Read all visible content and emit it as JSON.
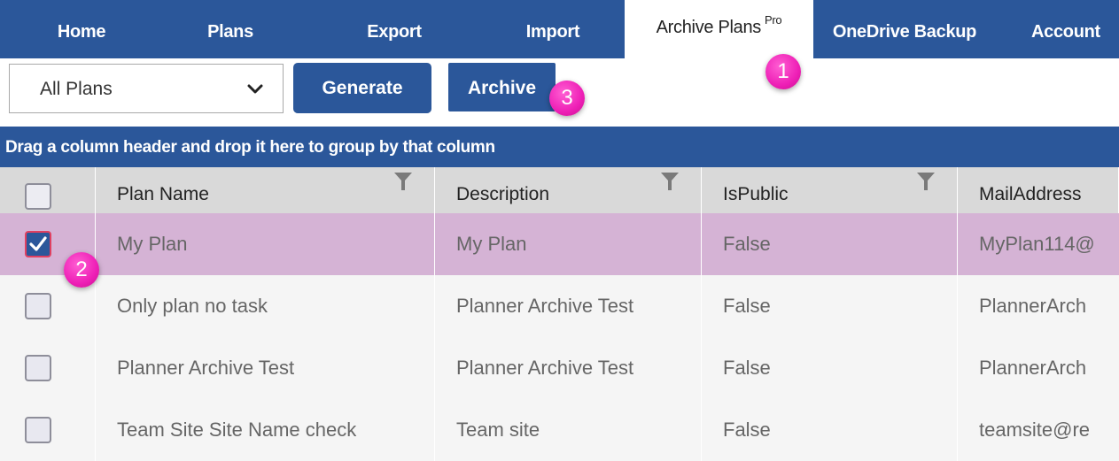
{
  "nav": {
    "tabs": [
      {
        "label": "Home"
      },
      {
        "label": "Plans"
      },
      {
        "label": "Export"
      },
      {
        "label": "Import"
      },
      {
        "label": "Archive Plans",
        "superscript": "Pro",
        "active": true
      },
      {
        "label": "OneDrive Backup"
      },
      {
        "label": "Account"
      }
    ]
  },
  "toolbar": {
    "plan_filter_value": "All Plans",
    "generate_label": "Generate",
    "archive_label": "Archive"
  },
  "badges": [
    "1",
    "2",
    "3"
  ],
  "grid": {
    "group_hint": "Drag a column header and drop it here to group by that column",
    "columns": [
      "Plan Name",
      "Description",
      "IsPublic",
      "MailAddress"
    ],
    "rows": [
      {
        "checked": true,
        "cells": [
          "My Plan",
          "My Plan",
          "False",
          "MyPlan114@"
        ]
      },
      {
        "checked": false,
        "cells": [
          "Only plan no task",
          "Planner Archive Test",
          "False",
          "PlannerArch"
        ]
      },
      {
        "checked": false,
        "cells": [
          "Planner Archive Test",
          "Planner Archive Test",
          "False",
          "PlannerArch"
        ]
      },
      {
        "checked": false,
        "cells": [
          "Team Site Site Name check",
          "Team site",
          "False",
          "teamsite@re"
        ]
      }
    ]
  },
  "colors": {
    "brand": "#2b579a",
    "selected_row": "#d5b3d5",
    "badge": "#ee1fb6"
  }
}
